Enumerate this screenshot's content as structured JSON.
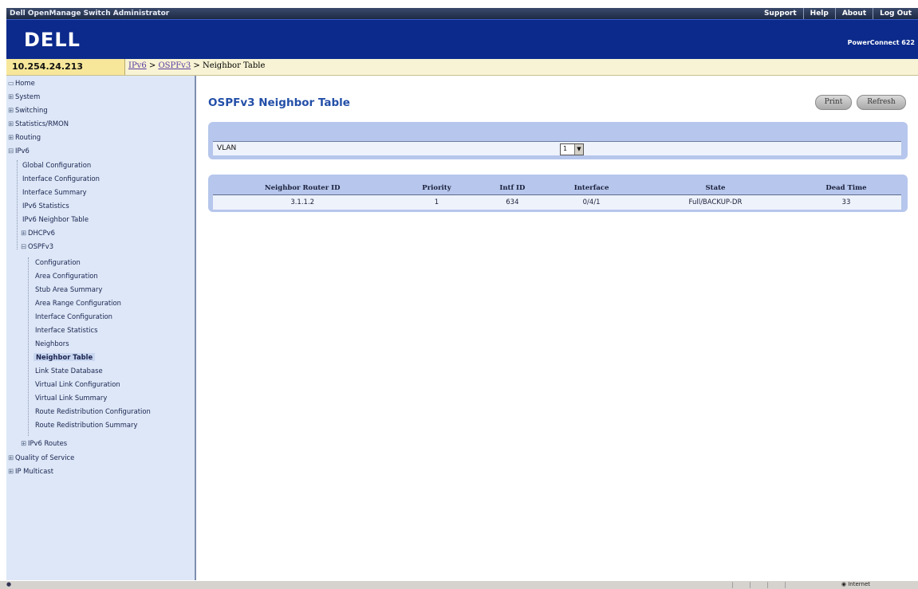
{
  "app_title": "Dell OpenManage Switch Administrator",
  "top_links": [
    "Support",
    "Help",
    "About",
    "Log Out"
  ],
  "brand": {
    "logo": "DELL",
    "product": "PowerConnect 622"
  },
  "address": {
    "ip": "10.254.24.213"
  },
  "breadcrumb": {
    "link1": "IPv6",
    "sep1": " > ",
    "link2": "OSPFv3",
    "sep2": " > ",
    "current": "Neighbor Table"
  },
  "sidebar": {
    "home": "Home",
    "system": "System",
    "switching": "Switching",
    "statistics": "Statistics/RMON",
    "routing": "Routing",
    "ipv6": "IPv6",
    "global_config": "Global Configuration",
    "interface_config": "Interface Configuration",
    "interface_summary": "Interface Summary",
    "ipv6_statistics": "IPv6 Statistics",
    "ipv6_neighbor_table": "IPv6 Neighbor Table",
    "dhcpv6": "DHCPv6",
    "ospfv3": "OSPFv3",
    "o_configuration": "Configuration",
    "o_area_config": "Area Configuration",
    "o_stub_area_summary": "Stub Area Summary",
    "o_area_range_config": "Area Range Configuration",
    "o_interface_config": "Interface Configuration",
    "o_interface_stats": "Interface Statistics",
    "o_neighbors": "Neighbors",
    "o_neighbor_table": "Neighbor Table",
    "o_lsdb": "Link State Database",
    "o_vlink_config": "Virtual Link Configuration",
    "o_vlink_summary": "Virtual Link Summary",
    "o_route_redist_config": "Route Redistribution Configuration",
    "o_route_redist_summary": "Route Redistribution Summary",
    "ipv6_routes": "IPv6 Routes",
    "qos": "Quality of Service",
    "ip_multicast": "IP Multicast"
  },
  "main": {
    "title": "OSPFv3 Neighbor Table",
    "print_label": "Print",
    "refresh_label": "Refresh",
    "vlan_label": "VLAN",
    "vlan_value": "1"
  },
  "table": {
    "headers": [
      "Neighbor Router ID",
      "Priority",
      "Intf ID",
      "Interface",
      "State",
      "Dead Time"
    ],
    "rows": [
      [
        "3.1.1.2",
        "1",
        "634",
        "0/4/1",
        "Full/BACKUP-DR",
        "33"
      ]
    ]
  },
  "statusbar": {
    "zone": "Internet"
  }
}
